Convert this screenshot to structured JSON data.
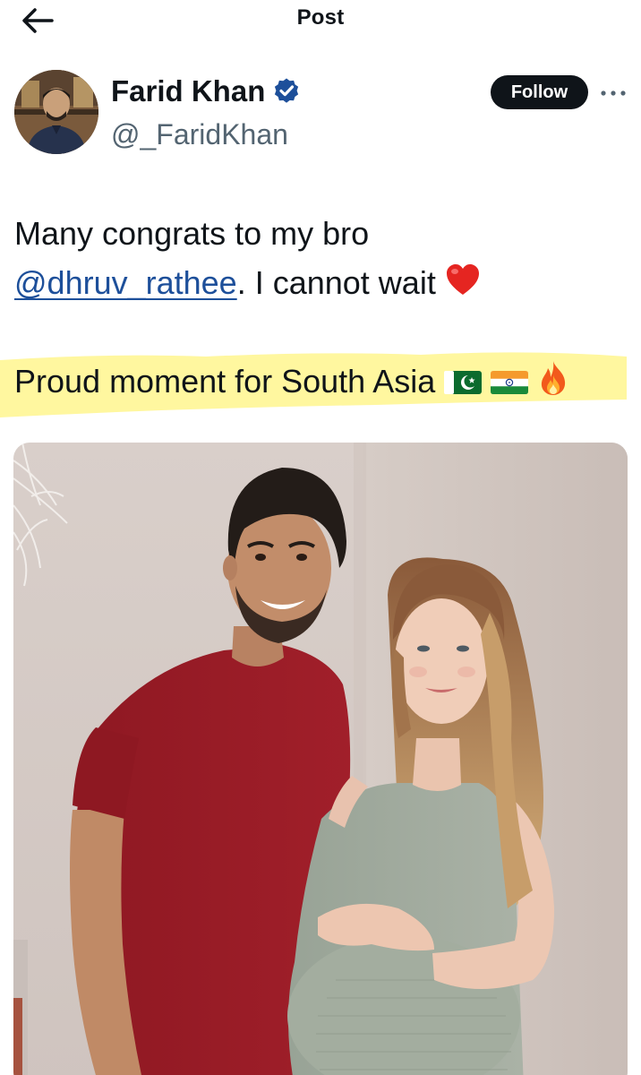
{
  "topbar": {
    "title": "Post",
    "back_icon": "arrow-left-icon"
  },
  "author": {
    "name": "Farid Khan",
    "handle": "@_FaridKhan",
    "verified": true,
    "verified_icon": "verified-badge-icon",
    "avatar": "avatar"
  },
  "actions": {
    "follow_label": "Follow",
    "more_icon": "more-horizontal-icon"
  },
  "post": {
    "line1": "Many congrats to my bro",
    "mention": "@dhruv_rathee",
    "line2_rest": ".  I cannot wait",
    "line2_emoji": "red-heart-icon",
    "line3": "Proud moment for South Asia",
    "line3_emojis": [
      "pakistan-flag-icon",
      "india-flag-icon",
      "fire-icon"
    ],
    "highlight_color": "#fff79a"
  },
  "media": {
    "kind": "photo",
    "description_icon": "post-photo"
  },
  "colors": {
    "text": "#0f1419",
    "secondary_text": "#536471",
    "link": "#1d4f9a",
    "verified": "#1d9bf0",
    "follow_bg": "#0f1419"
  }
}
